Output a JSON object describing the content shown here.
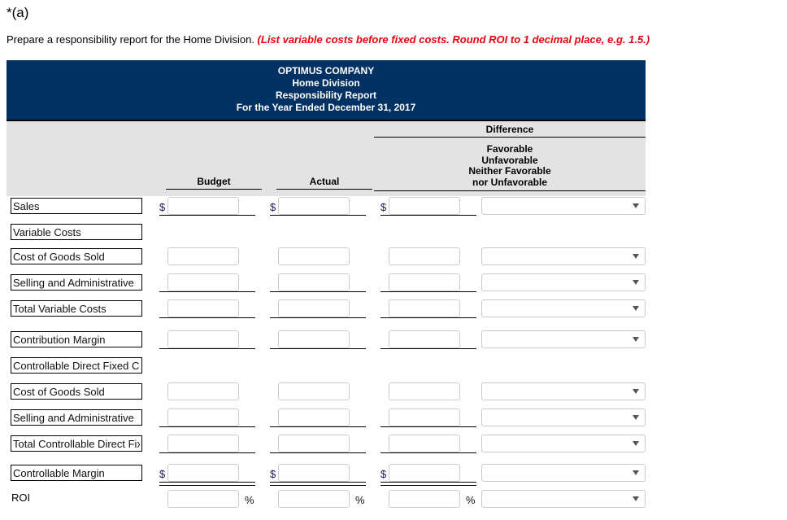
{
  "question": {
    "label": "*(a)",
    "prompt": "Prepare a responsibility report for the Home Division.",
    "hint": "(List variable costs before fixed costs. Round ROI to 1 decimal place, e.g. 1.5.)"
  },
  "report": {
    "title_lines": [
      "OPTIMUS COMPANY",
      "Home Division",
      "Responsibility Report",
      "For the Year Ended December 31, 2017"
    ],
    "headers": {
      "budget": "Budget",
      "actual": "Actual",
      "difference": "Difference",
      "difference_options": [
        "Favorable",
        "Unfavorable",
        "Neither Favorable",
        "nor Unfavorable"
      ]
    },
    "colors": {
      "title_band": "#023263",
      "header_band": "#e3e3e3",
      "hint_text": "#e8000d"
    },
    "rows": [
      {
        "label": "Sales",
        "label_editable": true,
        "budget": "",
        "actual": "",
        "difference": "",
        "prefix": "$",
        "suffix": "",
        "select": "",
        "has_inputs": true,
        "rule": "single"
      },
      {
        "label": "Variable Costs",
        "label_editable": true,
        "budget": "",
        "actual": "",
        "difference": "",
        "prefix": "",
        "suffix": "",
        "select": "",
        "has_inputs": false,
        "rule": "none"
      },
      {
        "label": "Cost of Goods Sold",
        "label_editable": true,
        "budget": "",
        "actual": "",
        "difference": "",
        "prefix": "",
        "suffix": "",
        "select": "",
        "has_inputs": true,
        "rule": "none"
      },
      {
        "label": "Selling and Administrative",
        "label_editable": true,
        "budget": "",
        "actual": "",
        "difference": "",
        "prefix": "",
        "suffix": "",
        "select": "",
        "has_inputs": true,
        "rule": "single"
      },
      {
        "label": "Total Variable Costs",
        "label_editable": true,
        "budget": "",
        "actual": "",
        "difference": "",
        "prefix": "",
        "suffix": "",
        "select": "",
        "has_inputs": true,
        "rule": "single"
      },
      {
        "label": "Contribution Margin",
        "label_editable": true,
        "budget": "",
        "actual": "",
        "difference": "",
        "prefix": "",
        "suffix": "",
        "select": "",
        "has_inputs": true,
        "rule": "single"
      },
      {
        "label": "Controllable Direct Fixed Costs",
        "label_editable": true,
        "budget": "",
        "actual": "",
        "difference": "",
        "prefix": "",
        "suffix": "",
        "select": "",
        "has_inputs": false,
        "rule": "none"
      },
      {
        "label": "Cost of Goods Sold",
        "label_editable": true,
        "budget": "",
        "actual": "",
        "difference": "",
        "prefix": "",
        "suffix": "",
        "select": "",
        "has_inputs": true,
        "rule": "none"
      },
      {
        "label": "Selling and Administrative",
        "label_editable": true,
        "budget": "",
        "actual": "",
        "difference": "",
        "prefix": "",
        "suffix": "",
        "select": "",
        "has_inputs": true,
        "rule": "single"
      },
      {
        "label": "Total Controllable Direct Fixed Costs",
        "label_editable": true,
        "budget": "",
        "actual": "",
        "difference": "",
        "prefix": "",
        "suffix": "",
        "select": "",
        "has_inputs": true,
        "rule": "single"
      },
      {
        "label": "Controllable Margin",
        "label_editable": true,
        "budget": "",
        "actual": "",
        "difference": "",
        "prefix": "$",
        "suffix": "",
        "select": "",
        "has_inputs": true,
        "rule": "double"
      },
      {
        "label": "ROI",
        "label_editable": false,
        "budget": "",
        "actual": "",
        "difference": "",
        "prefix": "",
        "suffix": "%",
        "select": "",
        "has_inputs": true,
        "rule": "none"
      }
    ]
  }
}
